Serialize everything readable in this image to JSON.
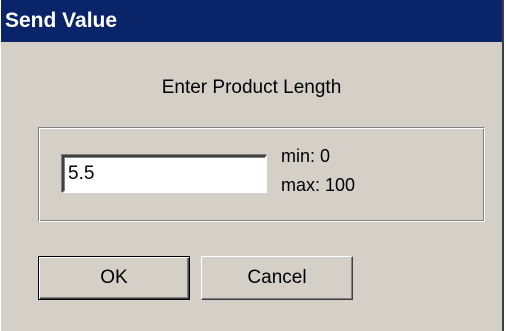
{
  "window": {
    "title": "Send Value"
  },
  "dialog": {
    "prompt": "Enter Product Length",
    "input_value": "5.5",
    "min_label": "min: 0",
    "max_label": "max: 100"
  },
  "buttons": {
    "ok_label": "OK",
    "cancel_label": "Cancel"
  },
  "colors": {
    "title_bar": "#0a246a",
    "dialog_face": "#d4d0c8"
  }
}
